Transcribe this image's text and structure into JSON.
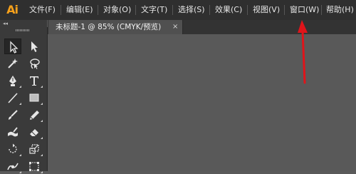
{
  "app": {
    "logo_text": "Ai",
    "accent": "#f7a11b"
  },
  "menu": [
    "文件(F)",
    "编辑(E)",
    "对象(O)",
    "文字(T)",
    "选择(S)",
    "效果(C)",
    "视图(V)",
    "窗口(W)",
    "帮助(H)"
  ],
  "panel": {
    "collapse_glyph": "◂◂"
  },
  "document_tab": {
    "title": "未标题-1 @ 85% (CMYK/预览)",
    "close_glyph": "×"
  },
  "annotation": {
    "color": "#e0141a",
    "points_to": "窗口(W)"
  },
  "tools": [
    "selection-tool",
    "direct-selection-tool",
    "magic-wand-tool",
    "lasso-tool",
    "pen-tool",
    "type-tool",
    "line-segment-tool",
    "rectangle-tool",
    "paintbrush-tool",
    "pencil-tool",
    "blob-brush-tool",
    "eraser-tool",
    "rotate-tool",
    "scale-tool",
    "warp-tool",
    "free-transform-tool"
  ]
}
